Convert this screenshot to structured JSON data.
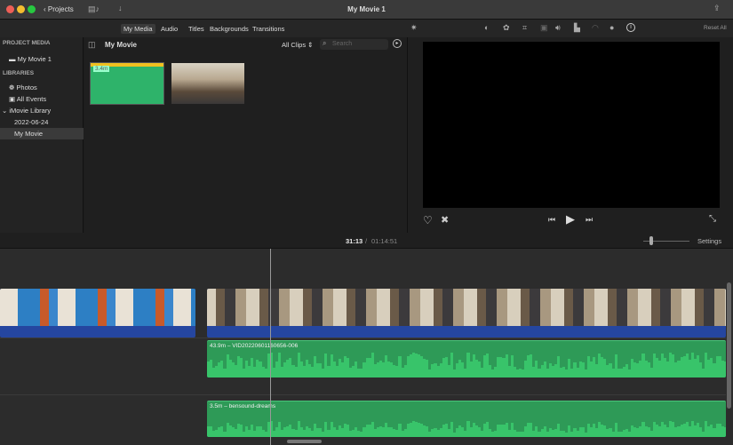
{
  "window": {
    "title": "My Movie 1",
    "back_label": "Projects"
  },
  "tabs": [
    "My Media",
    "Audio",
    "Titles",
    "Backgrounds",
    "Transitions"
  ],
  "viewer": {
    "reset_all": "Reset All"
  },
  "sidebar": {
    "project_media_header": "PROJECT MEDIA",
    "project": "My Movie 1",
    "libraries_header": "LIBRARIES",
    "items": [
      "Photos",
      "All Events",
      "iMovie Library",
      "2022-06-24",
      "My Movie"
    ]
  },
  "browser": {
    "title": "My Movie",
    "filter": "All Clips",
    "search_placeholder": "Search",
    "clip1_duration": "3.4m"
  },
  "timecode": {
    "current": "31:13",
    "separator": "/",
    "total": "01:14:51"
  },
  "timeline": {
    "settings": "Settings",
    "audio_clip": "43.9m – VID20220601160656-006",
    "music_clip": "3.5m – bensound-dreams"
  },
  "colors": {
    "audio": "#2e9a57",
    "video_band": "#2546a0",
    "accent_selected": "#3a3a3a"
  }
}
